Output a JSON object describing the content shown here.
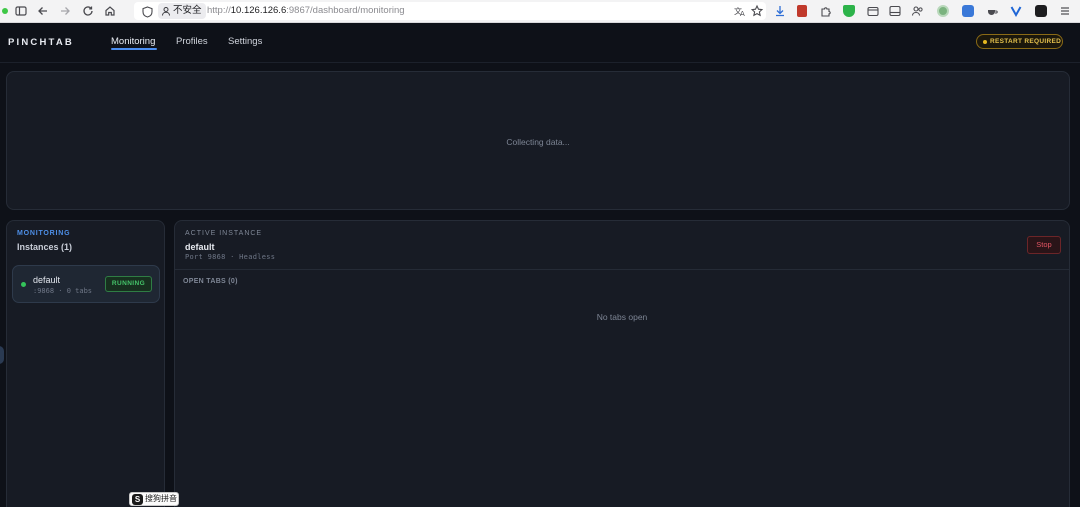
{
  "browser": {
    "security_label": "不安全",
    "url_prefix": "http://",
    "url_host": "10.126.126.6",
    "url_rest": ":9867/dashboard/monitoring",
    "icons": [
      "sidebar-toggle-icon",
      "back-icon",
      "forward-icon",
      "reload-icon",
      "home-icon",
      "shield-icon",
      "lock-warning-icon",
      "translate-icon",
      "bookmark-star-icon"
    ]
  },
  "app": {
    "brand": "PINCHTAB",
    "nav": {
      "monitoring": "Monitoring",
      "profiles": "Profiles",
      "settings": "Settings"
    },
    "restart_badge": "RESTART REQUIRED"
  },
  "chart": {
    "placeholder": "Collecting data..."
  },
  "sidebar": {
    "section_label": "MONITORING",
    "title": "Instances (1)",
    "instances": [
      {
        "name": "default",
        "meta": ":9868 · 0 tabs",
        "status": "RUNNING"
      }
    ]
  },
  "active_instance": {
    "section_label": "ACTIVE INSTANCE",
    "name": "default",
    "meta": "Port 9868 · Headless",
    "stop_label": "Stop",
    "open_tabs_label": "OPEN TABS (0)",
    "empty_tabs": "No tabs open"
  },
  "ime": {
    "label": "搜狗拼音",
    "logo": "S"
  },
  "colors": {
    "accent": "#4b8ef0",
    "running": "#34c35a",
    "warning": "#e6c24d",
    "danger": "#e25563"
  }
}
